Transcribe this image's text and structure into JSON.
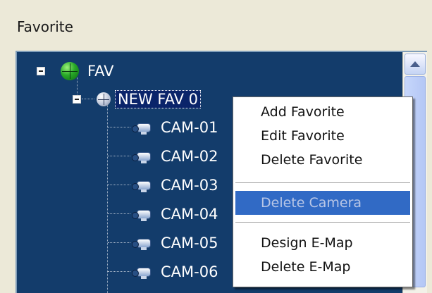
{
  "panel": {
    "title": "Favorite"
  },
  "tree": {
    "root": {
      "label": "FAV"
    },
    "group": {
      "label": "NEW FAV 0"
    },
    "cameras": [
      "CAM-01",
      "CAM-02",
      "CAM-03",
      "CAM-04",
      "CAM-05",
      "CAM-06"
    ]
  },
  "context_menu": {
    "items": [
      {
        "label": "Add Favorite",
        "state": "normal"
      },
      {
        "label": "Edit Favorite",
        "state": "normal"
      },
      {
        "label": "Delete Favorite",
        "state": "normal"
      },
      {
        "label": "Delete Camera",
        "state": "highlighted-disabled"
      },
      {
        "label": "Design E-Map",
        "state": "normal"
      },
      {
        "label": "Delete E-Map",
        "state": "normal"
      }
    ]
  },
  "icons": {
    "root": "globe-icon",
    "group": "globe-icon",
    "camera": "camera-icon",
    "collapse": "collapse-icon",
    "scroll_up": "scroll-up-arrow-icon"
  },
  "colors": {
    "tree_background": "#133c6b",
    "selection": "#0a246a",
    "menu_highlight": "#316ac5",
    "window_background": "#ece9d8"
  }
}
